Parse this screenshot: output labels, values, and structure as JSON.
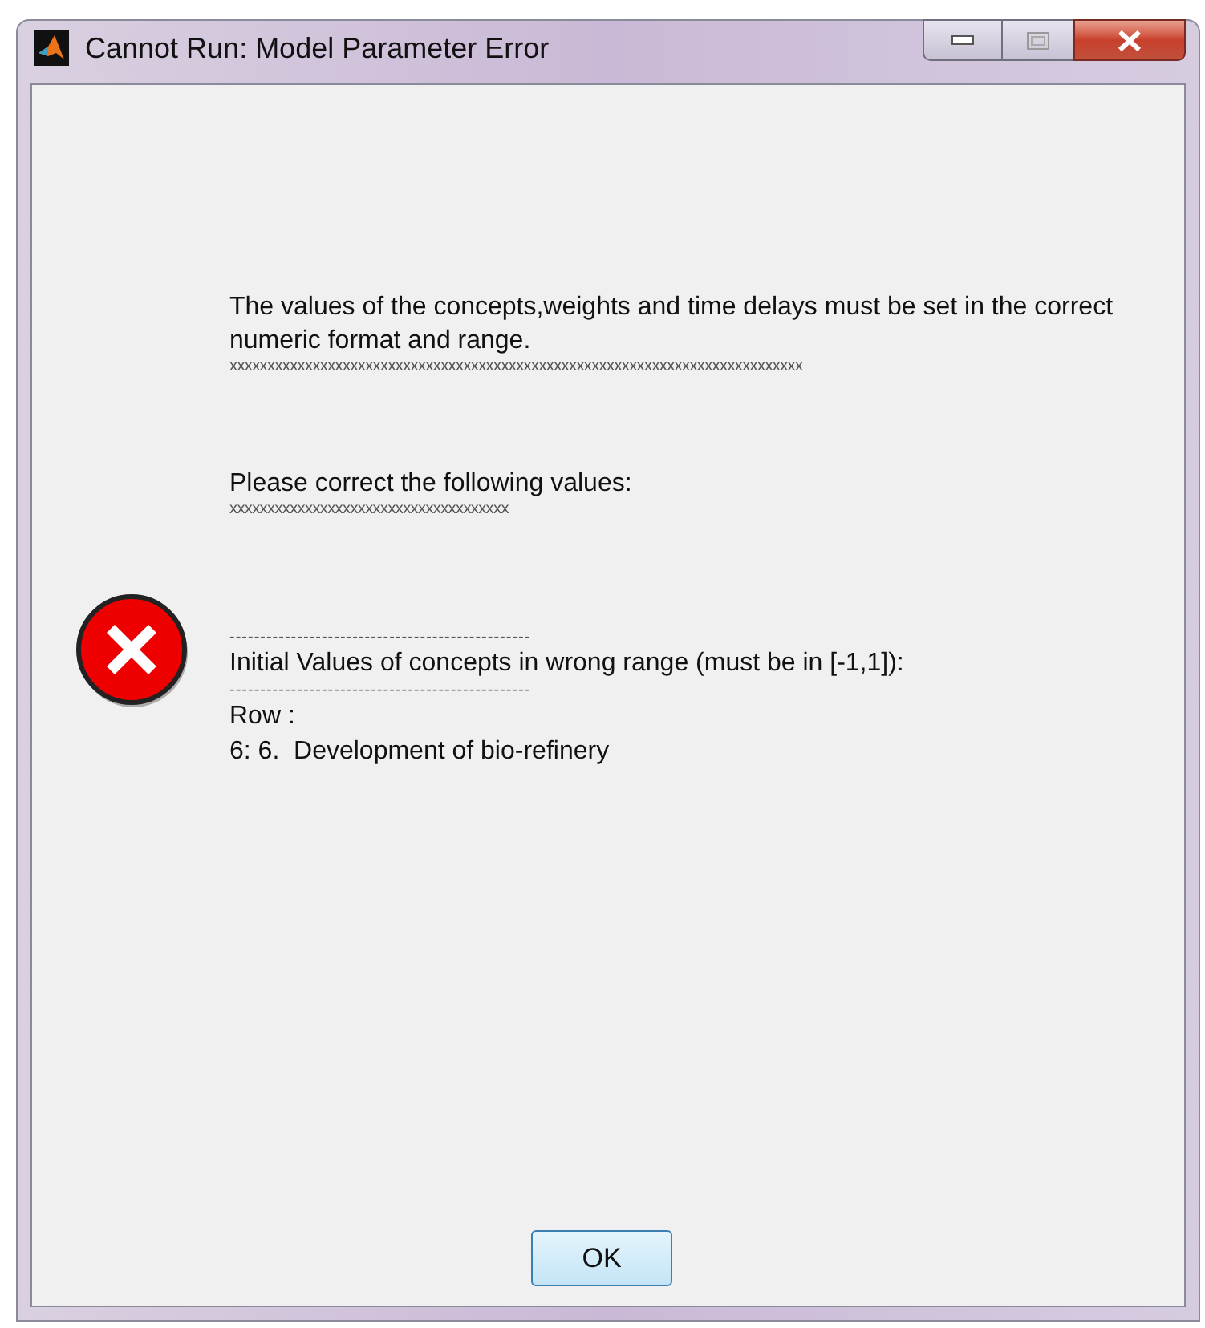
{
  "window": {
    "title": "Cannot Run: Model Parameter Error"
  },
  "message": {
    "intro": "The values of the concepts,weights and time delays must be set in the correct numeric format and range.",
    "intro_rule": "xxxxxxxxxxxxxxxxxxxxxxxxxxxxxxxxxxxxxxxxxxxxxxxxxxxxxxxxxxxxxxxxxxxxxxxxxxxx",
    "prompt": "Please correct the following values:",
    "prompt_rule": "xxxxxxxxxxxxxxxxxxxxxxxxxxxxxxxxxxxxx",
    "details": [
      {
        "kind": "rule",
        "text": "-------------------------------------------------"
      },
      {
        "kind": "line",
        "text": "Initial Values of concepts in wrong range (must be in [-1,1]):"
      },
      {
        "kind": "rule",
        "text": "-------------------------------------------------"
      },
      {
        "kind": "line",
        "text": "Row :"
      },
      {
        "kind": "line",
        "text": "6: 6.  Development of bio-refinery"
      }
    ]
  },
  "buttons": [
    "OK"
  ]
}
